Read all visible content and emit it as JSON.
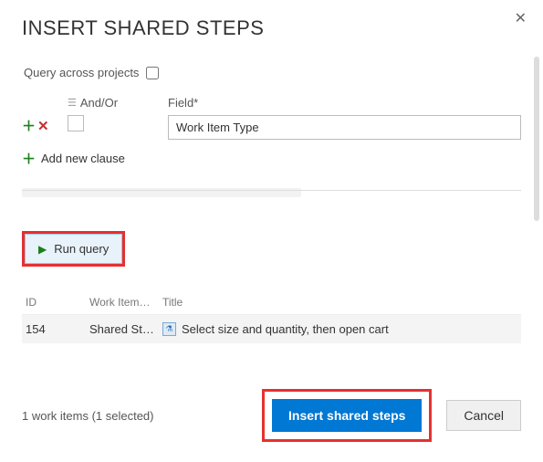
{
  "dialog": {
    "title": "INSERT SHARED STEPS",
    "query_across_label": "Query across projects"
  },
  "filter": {
    "andor_header": "And/Or",
    "field_header": "Field*",
    "field_value": "Work Item Type",
    "add_clause_label": "Add new clause"
  },
  "run_query_label": "Run query",
  "table": {
    "headers": {
      "id": "ID",
      "work_item": "Work Item…",
      "title": "Title"
    },
    "rows": [
      {
        "id": "154",
        "work_item": "Shared St…",
        "title": "Select size and quantity, then open cart"
      }
    ]
  },
  "footer": {
    "count_text": "1 work items (1 selected)",
    "insert_label": "Insert shared steps",
    "cancel_label": "Cancel"
  }
}
